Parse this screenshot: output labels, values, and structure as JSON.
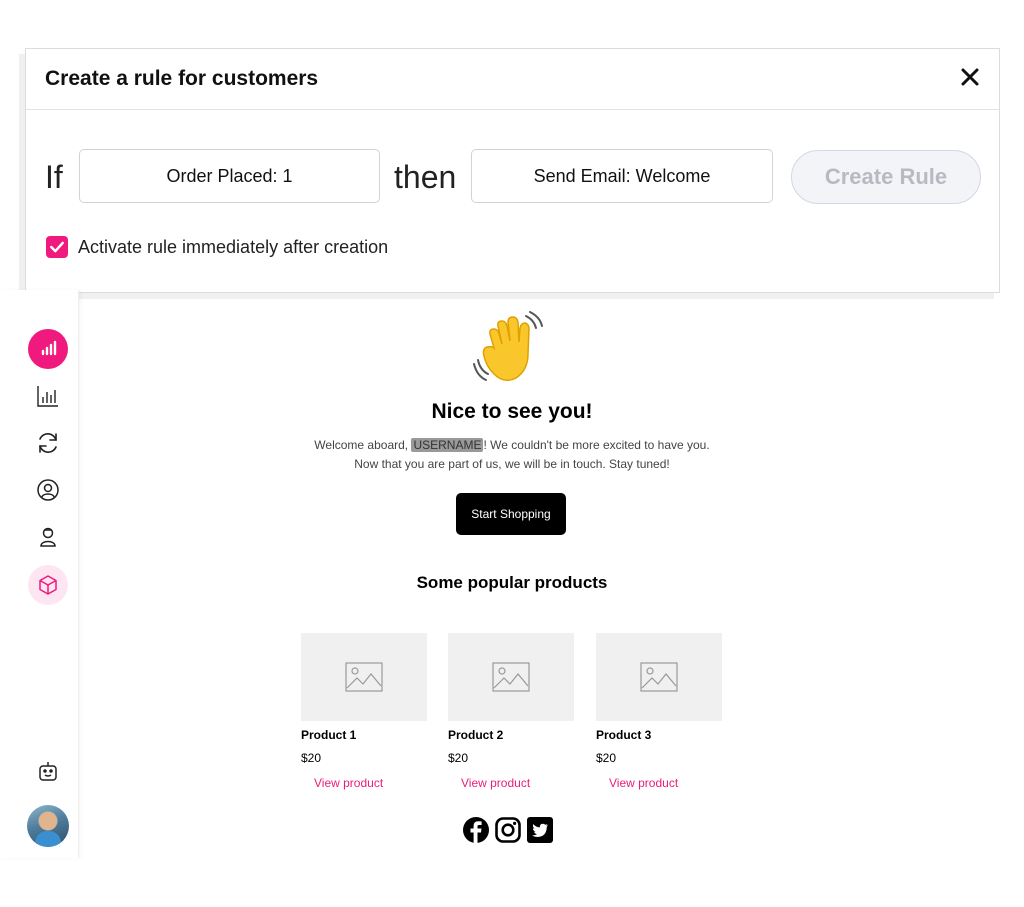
{
  "modal": {
    "title": "Create a rule for customers",
    "if_word": "If",
    "then_word": "then",
    "trigger_value": "Order Placed: 1",
    "action_value": "Send Email: Welcome",
    "create_button": "Create Rule",
    "activate_label": "Activate rule immediately after creation",
    "activate_checked": true
  },
  "sidebar": {
    "items": [
      {
        "icon": "signal-bars-icon",
        "active": true
      },
      {
        "icon": "bar-chart-icon"
      },
      {
        "icon": "refresh-icon"
      },
      {
        "icon": "user-circle-icon"
      },
      {
        "icon": "person-pin-icon"
      },
      {
        "icon": "box-icon",
        "highlighted": true
      }
    ],
    "bottom": [
      {
        "icon": "chatbot-icon"
      },
      {
        "icon": "avatar"
      }
    ]
  },
  "email": {
    "emoji": "👋",
    "title": "Nice to see you!",
    "welcome_prefix": "Welcome aboard, ",
    "username_tag": "USERNAME",
    "welcome_suffix": "! We couldn't be more excited to have you.",
    "line2": "Now that you are part of us, we will be in touch. Stay tuned!",
    "cta": "Start Shopping",
    "products_heading": "Some popular products",
    "products": [
      {
        "name": "Product 1",
        "price": "$20",
        "link": "View product"
      },
      {
        "name": "Product 2",
        "price": "$20",
        "link": "View product"
      },
      {
        "name": "Product 3",
        "price": "$20",
        "link": "View product"
      }
    ],
    "social": [
      "facebook-icon",
      "instagram-icon",
      "twitter-icon"
    ]
  },
  "colors": {
    "accent": "#f0197d",
    "link": "#e91e7a",
    "button_disabled": "#f3f4f8"
  }
}
